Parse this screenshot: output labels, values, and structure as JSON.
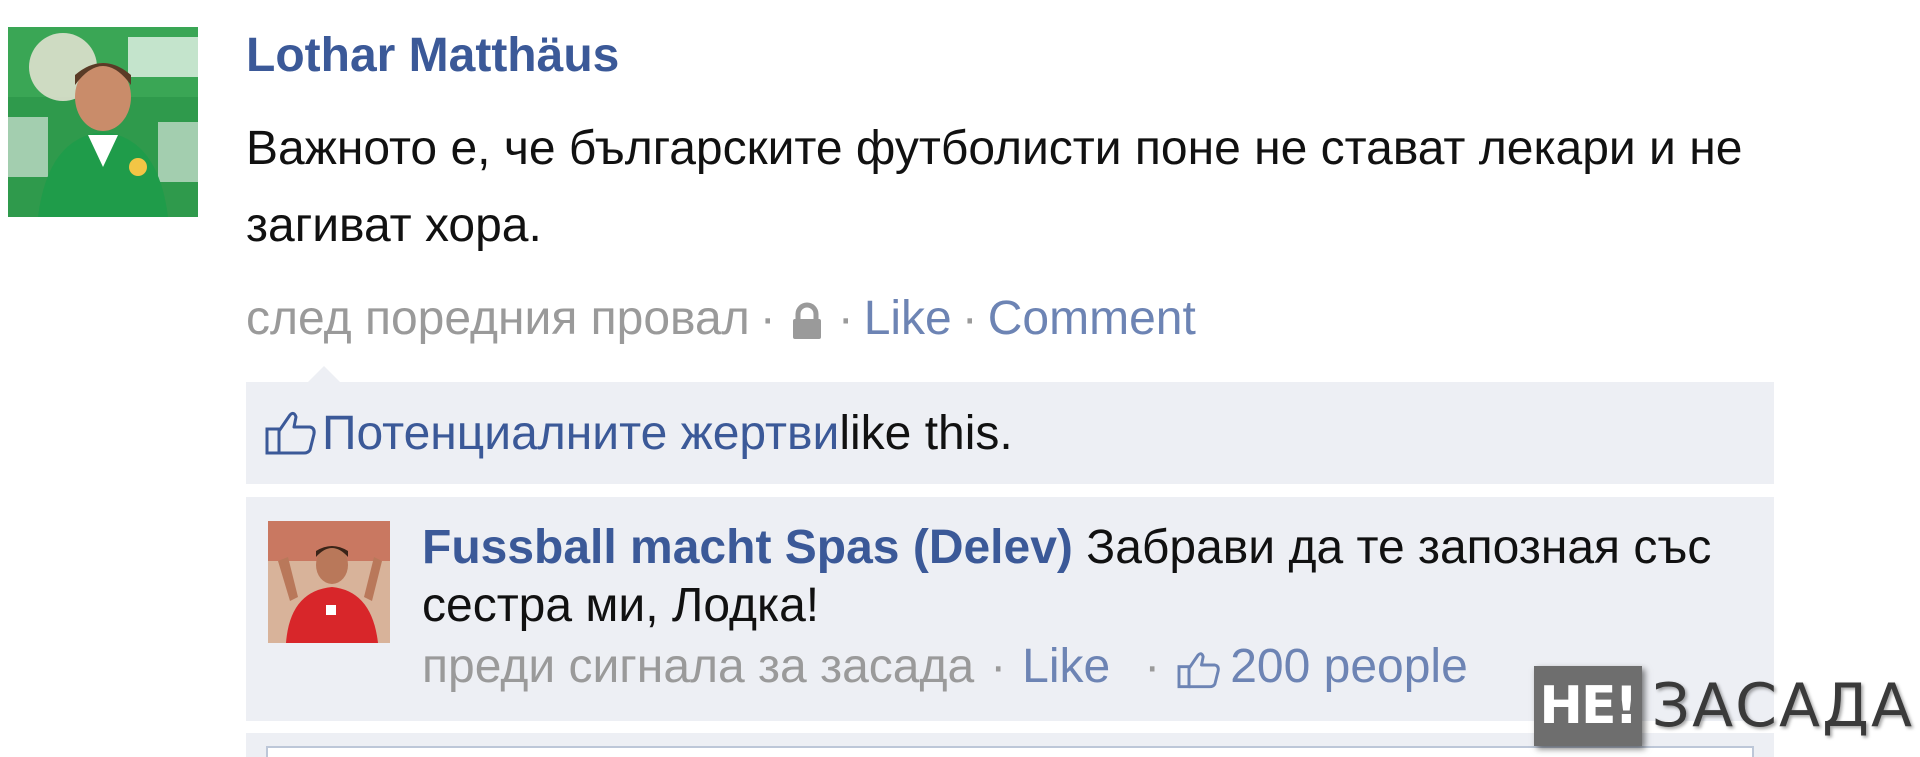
{
  "post": {
    "author": "Lothar Matthäus",
    "text": "Важното е, че българските футболисти поне не стават лекари и не загиват хора.",
    "timestamp": "след поредния провал",
    "separator": "·",
    "like_label": "Like",
    "comment_label": "Comment",
    "privacy_icon": "lock-icon"
  },
  "likes": {
    "likers": "Потенциалните жертви",
    "suffix": "like this."
  },
  "comment": {
    "author": "Fussball macht Spas (Delev)",
    "text": "Забрави да те запозная със сестра ми, Лодка!",
    "timestamp": "преди сигнала за засада",
    "separator": "·",
    "like_label": "Like",
    "like_count": "200 people"
  },
  "watermark": {
    "logo": "НЕ!",
    "text": "ЗАСАДА"
  },
  "colors": {
    "link_blue": "#3b5998",
    "link_light": "#6d84b4",
    "meta_gray": "#9a9a9a",
    "panel_bg": "#edeff4"
  }
}
